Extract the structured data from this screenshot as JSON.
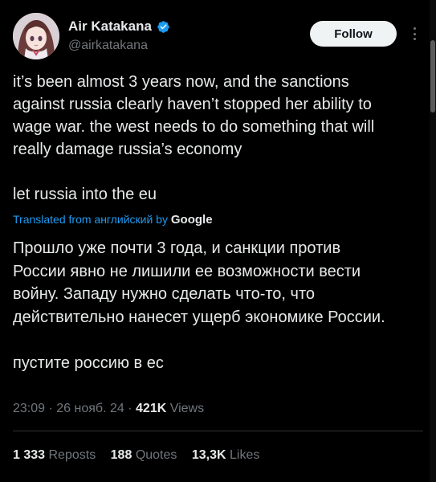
{
  "author": {
    "display_name": "Air Katakana",
    "handle": "@airkatakana",
    "verified": true,
    "avatar_icon": "anime-girl-avatar"
  },
  "follow_label": "Follow",
  "more_icon": "more-vertical-icon",
  "tweet": {
    "text_lines": [
      "it’s been almost 3 years now, and the sanctions",
      "against russia clearly haven’t stopped her ability to",
      "wage war. the west needs to do something that will",
      "really damage russia’s economy",
      "",
      "let russia into the eu"
    ],
    "translated_prefix": "Translated from английский by",
    "translator": "Google",
    "translated_lines": [
      "Прошло уже почти 3 года, и санкции против",
      "России явно не лишили ее возможности вести",
      "войну. Западу нужно сделать что-то, что",
      "действительно нанесет ущерб экономике России.",
      "",
      "пустите россию в ес"
    ]
  },
  "meta": {
    "time": "23:09",
    "date": "26 нояб. 24",
    "views_count": "421K",
    "views_label": "Views"
  },
  "stats": {
    "reposts_count": "1 333",
    "reposts_label": "Reposts",
    "quotes_count": "188",
    "quotes_label": "Quotes",
    "likes_count": "13,3K",
    "likes_label": "Likes"
  },
  "colors": {
    "background": "#000000",
    "text": "#e7e9ea",
    "muted": "#71767b",
    "accent": "#1d9bf0",
    "follow_bg": "#eff3f4"
  }
}
